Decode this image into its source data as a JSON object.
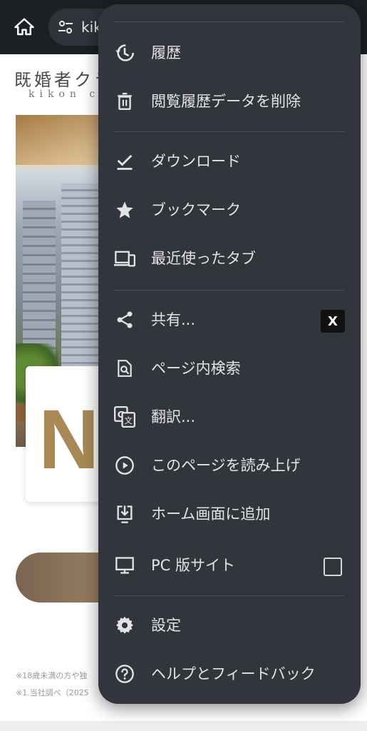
{
  "browser": {
    "url_text": "kik",
    "home_icon": "home-icon",
    "site_settings_icon": "tune-icon"
  },
  "page": {
    "brand_jp": "既婚者クラ",
    "brand_en": "kikon clu",
    "card_letter": "N",
    "notes": [
      "※18歳未満の方や独",
      "※1.当社調べ（2025"
    ]
  },
  "menu": {
    "items": [
      {
        "label": "履歴",
        "icon": "history-icon"
      },
      {
        "label": "閲覧履歴データを削除",
        "icon": "trash-icon"
      },
      {
        "label": "ダウンロード",
        "icon": "download-check-icon"
      },
      {
        "label": "ブックマーク",
        "icon": "star-icon"
      },
      {
        "label": "最近使ったタブ",
        "icon": "devices-icon"
      },
      {
        "label": "共有...",
        "icon": "share-icon",
        "trailing": "X"
      },
      {
        "label": "ページ内検索",
        "icon": "find-in-page-icon"
      },
      {
        "label": "翻訳...",
        "icon": "translate-icon"
      },
      {
        "label": "このページを読み上げ",
        "icon": "play-circle-icon"
      },
      {
        "label": "ホーム画面に追加",
        "icon": "add-to-home-icon"
      },
      {
        "label": "PC 版サイト",
        "icon": "monitor-icon",
        "checked": false
      },
      {
        "label": "設定",
        "icon": "gear-icon"
      },
      {
        "label": "ヘルプとフィードバック",
        "icon": "help-icon"
      }
    ]
  },
  "colors": {
    "menu_bg": "#32353b",
    "menu_text": "#e3e3e3",
    "topbar_bg": "#1c1f24",
    "accent_gold": "#a88955"
  }
}
